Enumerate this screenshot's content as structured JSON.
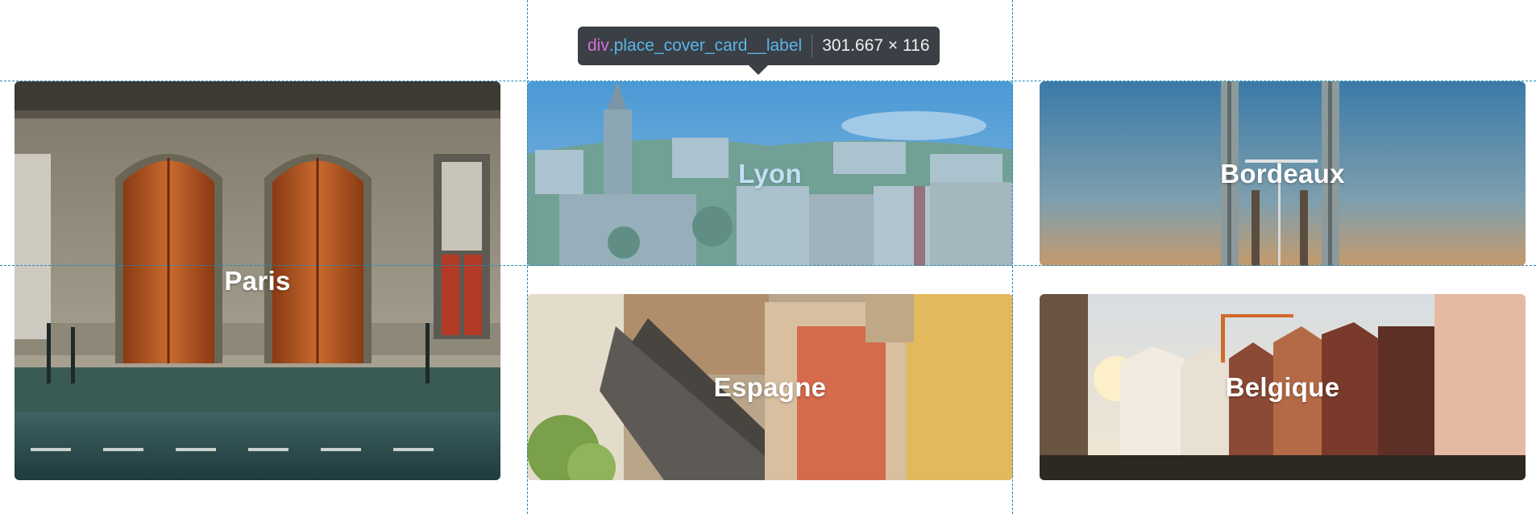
{
  "cards": [
    {
      "label": "Paris"
    },
    {
      "label": "Lyon"
    },
    {
      "label": "Bordeaux"
    },
    {
      "label": "Espagne"
    },
    {
      "label": "Belgique"
    }
  ],
  "inspector": {
    "tag": "div",
    "class_name": ".place_cover_card__label",
    "size": "301.667 × 116",
    "highlight_color": "#60aadc",
    "guide_color": "#1f8ab8"
  }
}
